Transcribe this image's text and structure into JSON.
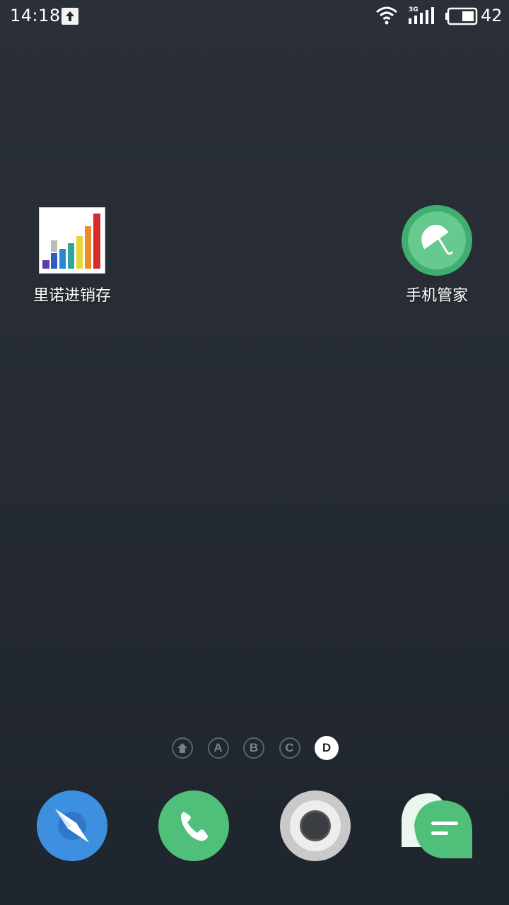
{
  "status_bar": {
    "time": "14:18",
    "network_type": "3G",
    "battery_level": "42",
    "icons": [
      "upload-notification-icon",
      "wifi-icon",
      "signal-icon",
      "battery-icon"
    ]
  },
  "desktop": {
    "apps": [
      {
        "label": "里诺进销存",
        "icon": "bar-chart-app-icon"
      },
      {
        "label": "手机管家",
        "icon": "umbrella-icon"
      }
    ]
  },
  "page_indicators": {
    "pages": [
      "home",
      "A",
      "B",
      "C",
      "D"
    ],
    "active": "D"
  },
  "dock": {
    "items": [
      {
        "name": "browser",
        "icon": "compass-icon",
        "color": "#3d8fe0"
      },
      {
        "name": "phone",
        "icon": "phone-icon",
        "color": "#4fbf7a"
      },
      {
        "name": "camera",
        "icon": "camera-icon",
        "color": "#c9c9c9"
      },
      {
        "name": "messages",
        "icon": "message-icon",
        "color": "#4fbf7a"
      }
    ]
  }
}
